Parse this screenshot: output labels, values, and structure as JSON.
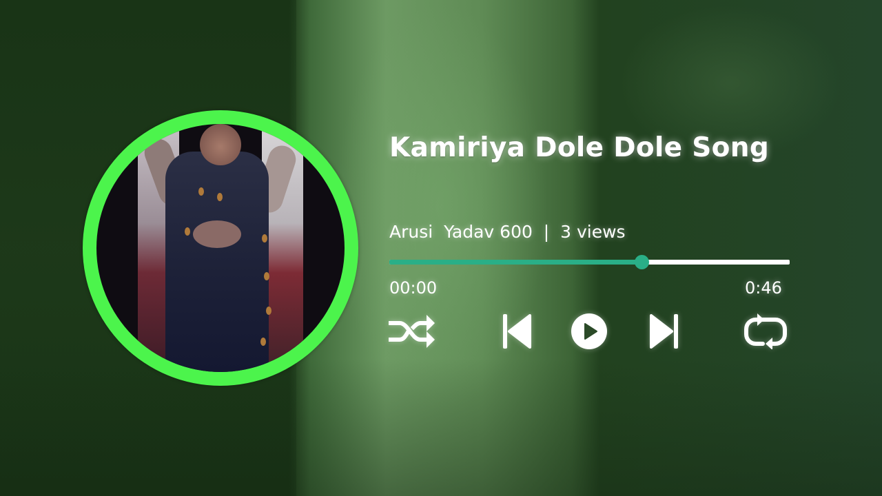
{
  "track": {
    "title": "Kamiriya Dole Dole Song",
    "meta": "Arusi  Yadav 600  |  3 views"
  },
  "playback": {
    "current_time": "00:00",
    "duration": "0:46",
    "progress_fraction": 0.63
  },
  "controls": {
    "shuffle_icon": "shuffle-icon",
    "previous_icon": "skip-previous-icon",
    "play_icon": "play-icon",
    "next_icon": "skip-next-icon",
    "repeat_icon": "repeat-icon"
  },
  "colors": {
    "ring": "#4cf44c",
    "accent": "#2aaf87",
    "track": "#ffffff",
    "text": "#ffffff"
  }
}
